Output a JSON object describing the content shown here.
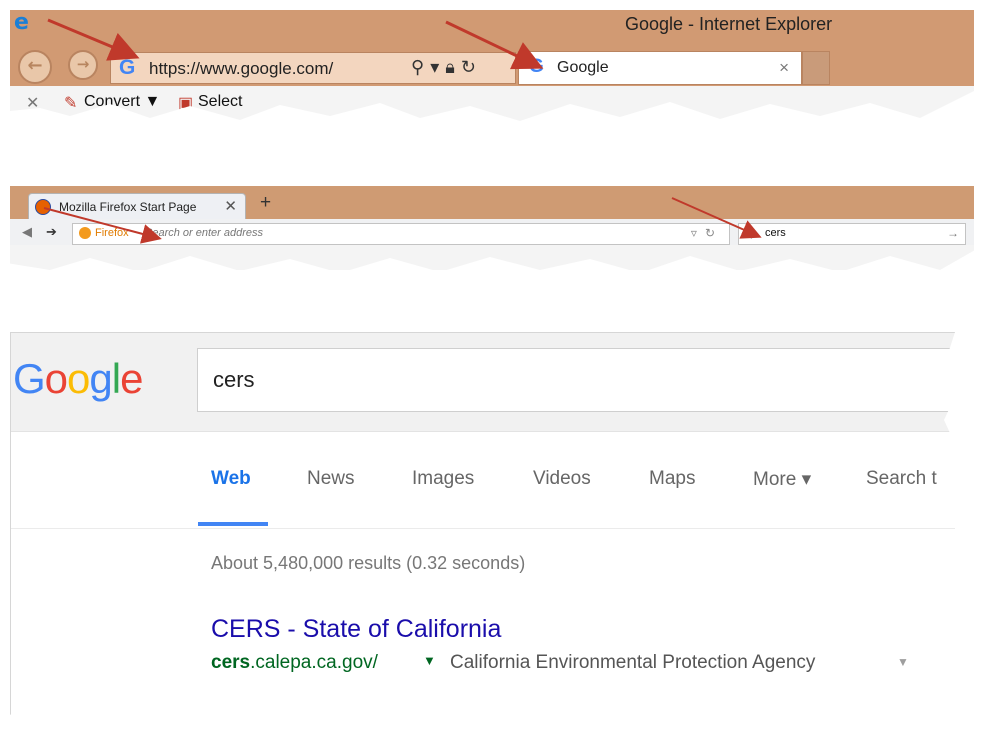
{
  "ie": {
    "window_title": "Google - Internet Explorer",
    "url": "https://www.google.com/",
    "tab_label": "Google",
    "tab_close": "×",
    "favorites": [
      {
        "label": "Convert ▼"
      },
      {
        "label": "Select"
      }
    ]
  },
  "firefox": {
    "tab_label": "Mozilla Firefox Start Page",
    "tab_close": "✕",
    "new_tab": "+",
    "url_brand": "Firefox",
    "url_placeholder": "Search or enter address",
    "search_value": "cers"
  },
  "google": {
    "logo_letters": [
      "G",
      "o",
      "o",
      "g",
      "l",
      "e"
    ],
    "logo_colors": [
      "#4285f4",
      "#ea4335",
      "#fbbc05",
      "#4285f4",
      "#34a853",
      "#ea4335"
    ],
    "query": "cers",
    "tabs": [
      "Web",
      "News",
      "Images",
      "Videos",
      "Maps",
      "More ▾",
      "Search t"
    ],
    "active_tab": "Web",
    "result_stats": "About 5,480,000 results (0.32 seconds)",
    "result": {
      "title": "CERS - State of California",
      "url_bold": "cers",
      "url_rest": ".calepa.ca.gov/",
      "site_name": "California Environmental Protection Agency"
    }
  },
  "colors": {
    "ie_frame": "#d19a73",
    "firefox_frame": "#cf9b73",
    "annotation_arrow": "#c0392b",
    "link_title": "#1a0dab",
    "link_url": "#006621"
  }
}
